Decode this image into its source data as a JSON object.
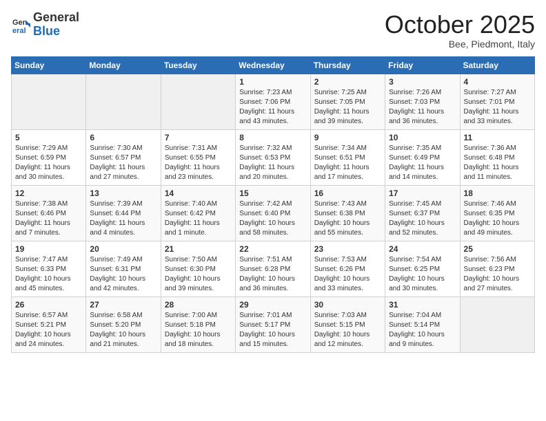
{
  "header": {
    "logo_general": "General",
    "logo_blue": "Blue",
    "month_title": "October 2025",
    "location": "Bee, Piedmont, Italy"
  },
  "days_of_week": [
    "Sunday",
    "Monday",
    "Tuesday",
    "Wednesday",
    "Thursday",
    "Friday",
    "Saturday"
  ],
  "weeks": [
    [
      {
        "day": "",
        "info": ""
      },
      {
        "day": "",
        "info": ""
      },
      {
        "day": "",
        "info": ""
      },
      {
        "day": "1",
        "info": "Sunrise: 7:23 AM\nSunset: 7:06 PM\nDaylight: 11 hours and 43 minutes."
      },
      {
        "day": "2",
        "info": "Sunrise: 7:25 AM\nSunset: 7:05 PM\nDaylight: 11 hours and 39 minutes."
      },
      {
        "day": "3",
        "info": "Sunrise: 7:26 AM\nSunset: 7:03 PM\nDaylight: 11 hours and 36 minutes."
      },
      {
        "day": "4",
        "info": "Sunrise: 7:27 AM\nSunset: 7:01 PM\nDaylight: 11 hours and 33 minutes."
      }
    ],
    [
      {
        "day": "5",
        "info": "Sunrise: 7:29 AM\nSunset: 6:59 PM\nDaylight: 11 hours and 30 minutes."
      },
      {
        "day": "6",
        "info": "Sunrise: 7:30 AM\nSunset: 6:57 PM\nDaylight: 11 hours and 27 minutes."
      },
      {
        "day": "7",
        "info": "Sunrise: 7:31 AM\nSunset: 6:55 PM\nDaylight: 11 hours and 23 minutes."
      },
      {
        "day": "8",
        "info": "Sunrise: 7:32 AM\nSunset: 6:53 PM\nDaylight: 11 hours and 20 minutes."
      },
      {
        "day": "9",
        "info": "Sunrise: 7:34 AM\nSunset: 6:51 PM\nDaylight: 11 hours and 17 minutes."
      },
      {
        "day": "10",
        "info": "Sunrise: 7:35 AM\nSunset: 6:49 PM\nDaylight: 11 hours and 14 minutes."
      },
      {
        "day": "11",
        "info": "Sunrise: 7:36 AM\nSunset: 6:48 PM\nDaylight: 11 hours and 11 minutes."
      }
    ],
    [
      {
        "day": "12",
        "info": "Sunrise: 7:38 AM\nSunset: 6:46 PM\nDaylight: 11 hours and 7 minutes."
      },
      {
        "day": "13",
        "info": "Sunrise: 7:39 AM\nSunset: 6:44 PM\nDaylight: 11 hours and 4 minutes."
      },
      {
        "day": "14",
        "info": "Sunrise: 7:40 AM\nSunset: 6:42 PM\nDaylight: 11 hours and 1 minute."
      },
      {
        "day": "15",
        "info": "Sunrise: 7:42 AM\nSunset: 6:40 PM\nDaylight: 10 hours and 58 minutes."
      },
      {
        "day": "16",
        "info": "Sunrise: 7:43 AM\nSunset: 6:38 PM\nDaylight: 10 hours and 55 minutes."
      },
      {
        "day": "17",
        "info": "Sunrise: 7:45 AM\nSunset: 6:37 PM\nDaylight: 10 hours and 52 minutes."
      },
      {
        "day": "18",
        "info": "Sunrise: 7:46 AM\nSunset: 6:35 PM\nDaylight: 10 hours and 49 minutes."
      }
    ],
    [
      {
        "day": "19",
        "info": "Sunrise: 7:47 AM\nSunset: 6:33 PM\nDaylight: 10 hours and 45 minutes."
      },
      {
        "day": "20",
        "info": "Sunrise: 7:49 AM\nSunset: 6:31 PM\nDaylight: 10 hours and 42 minutes."
      },
      {
        "day": "21",
        "info": "Sunrise: 7:50 AM\nSunset: 6:30 PM\nDaylight: 10 hours and 39 minutes."
      },
      {
        "day": "22",
        "info": "Sunrise: 7:51 AM\nSunset: 6:28 PM\nDaylight: 10 hours and 36 minutes."
      },
      {
        "day": "23",
        "info": "Sunrise: 7:53 AM\nSunset: 6:26 PM\nDaylight: 10 hours and 33 minutes."
      },
      {
        "day": "24",
        "info": "Sunrise: 7:54 AM\nSunset: 6:25 PM\nDaylight: 10 hours and 30 minutes."
      },
      {
        "day": "25",
        "info": "Sunrise: 7:56 AM\nSunset: 6:23 PM\nDaylight: 10 hours and 27 minutes."
      }
    ],
    [
      {
        "day": "26",
        "info": "Sunrise: 6:57 AM\nSunset: 5:21 PM\nDaylight: 10 hours and 24 minutes."
      },
      {
        "day": "27",
        "info": "Sunrise: 6:58 AM\nSunset: 5:20 PM\nDaylight: 10 hours and 21 minutes."
      },
      {
        "day": "28",
        "info": "Sunrise: 7:00 AM\nSunset: 5:18 PM\nDaylight: 10 hours and 18 minutes."
      },
      {
        "day": "29",
        "info": "Sunrise: 7:01 AM\nSunset: 5:17 PM\nDaylight: 10 hours and 15 minutes."
      },
      {
        "day": "30",
        "info": "Sunrise: 7:03 AM\nSunset: 5:15 PM\nDaylight: 10 hours and 12 minutes."
      },
      {
        "day": "31",
        "info": "Sunrise: 7:04 AM\nSunset: 5:14 PM\nDaylight: 10 hours and 9 minutes."
      },
      {
        "day": "",
        "info": ""
      }
    ]
  ]
}
